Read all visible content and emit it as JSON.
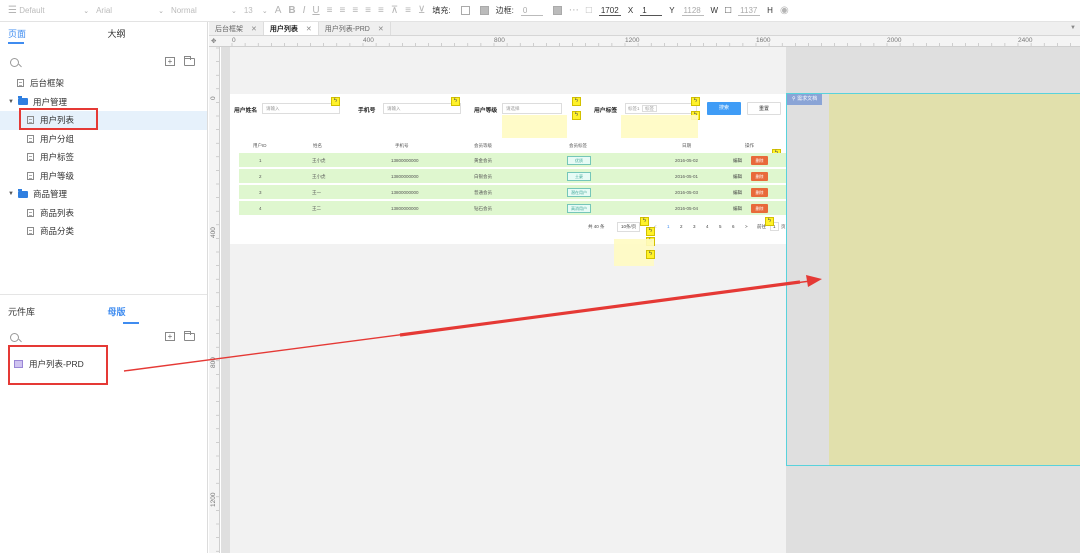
{
  "toolbar": {
    "style_select": "Default",
    "font_select": "Arial",
    "weight_select": "Normal",
    "font_size": "13",
    "text_a": "A",
    "bold": "B",
    "italic": "I",
    "underline": "U",
    "fill_label": "填充:",
    "border_label": "边框:",
    "border_value": "0",
    "x_value": "1702",
    "x_label": "X",
    "y_value": "1",
    "y_label": "Y",
    "w_value": "1128",
    "w_label": "W",
    "h_value": "1137",
    "h_label": "H"
  },
  "left_panel": {
    "tabs": [
      "页面",
      "大纲"
    ],
    "active_tab": "页面",
    "tree": [
      {
        "label": "后台框架",
        "type": "page",
        "level": 0
      },
      {
        "label": "用户管理",
        "type": "folder",
        "level": 0,
        "expanded": true
      },
      {
        "label": "用户列表",
        "type": "page",
        "level": 1,
        "selected": true
      },
      {
        "label": "用户分组",
        "type": "page",
        "level": 1
      },
      {
        "label": "用户标签",
        "type": "page",
        "level": 1
      },
      {
        "label": "用户等级",
        "type": "page",
        "level": 1
      },
      {
        "label": "商品管理",
        "type": "folder",
        "level": 0,
        "expanded": true
      },
      {
        "label": "商品列表",
        "type": "page",
        "level": 1
      },
      {
        "label": "商品分类",
        "type": "page",
        "level": 1
      }
    ],
    "lib_tabs": [
      "元件库",
      "母版"
    ],
    "active_lib_tab": "母版",
    "masters": [
      {
        "label": "用户列表-PRD"
      }
    ]
  },
  "doc_tabs": [
    {
      "label": "后台框架",
      "active": false
    },
    {
      "label": "用户列表",
      "active": true
    },
    {
      "label": "用户列表-PRD",
      "active": false
    }
  ],
  "ruler": {
    "h_ticks": [
      "0",
      "400",
      "800",
      "1200",
      "1600",
      "2000",
      "2400"
    ],
    "v_ticks": [
      "0",
      "400",
      "800",
      "1200"
    ]
  },
  "mockup": {
    "filters": {
      "name_label": "用户姓名",
      "name_placeholder": "请输入",
      "phone_label": "手机号",
      "phone_placeholder": "请输入",
      "level_label": "用户等级",
      "level_placeholder": "请选择",
      "tag_label": "用户标签",
      "tag_chip_1": "标签1",
      "tag_chip_2": "标签",
      "search_button": "搜索",
      "reset_button": "重置"
    },
    "table": {
      "headers": [
        "用户ID",
        "姓名",
        "手机号",
        "会员等级",
        "会员标签",
        "日期",
        "操作"
      ],
      "rows": [
        {
          "id": "1",
          "name": "王小虎",
          "phone": "13800000000",
          "level": "黄金会员",
          "tag": "优质",
          "date": "2016-05-02",
          "edit": "编辑",
          "delete": "删除"
        },
        {
          "id": "2",
          "name": "王小虎",
          "phone": "13800000000",
          "level": "白银会员",
          "tag": "土豪",
          "date": "2016-05-01",
          "edit": "编辑",
          "delete": "删除"
        },
        {
          "id": "3",
          "name": "王一",
          "phone": "13800000000",
          "level": "普通会员",
          "tag": "潜在用户",
          "date": "2016-05-03",
          "edit": "编辑",
          "delete": "删除"
        },
        {
          "id": "4",
          "name": "王二",
          "phone": "13800000000",
          "level": "钻石会员",
          "tag": "高消用户",
          "date": "2016-05-04",
          "edit": "编辑",
          "delete": "删除"
        }
      ]
    },
    "pagination": {
      "total": "共 40 条",
      "page_size": "10条/页",
      "prev": "<",
      "pages": [
        "1",
        "2",
        "3",
        "4",
        "5",
        "6"
      ],
      "next": ">",
      "goto_prefix": "前往",
      "goto_value": "1",
      "goto_suffix": "页"
    },
    "note_icon": "ϟ"
  },
  "master_panel": {
    "tag_label": "需求文档"
  },
  "colors": {
    "accent": "#3f8cf0",
    "red_highlight": "#e53935",
    "row_green": "#dff7cf",
    "master_yellow": "#e1e0ac",
    "master_border": "#58d2dc",
    "note_yellow": "#fff22a"
  }
}
